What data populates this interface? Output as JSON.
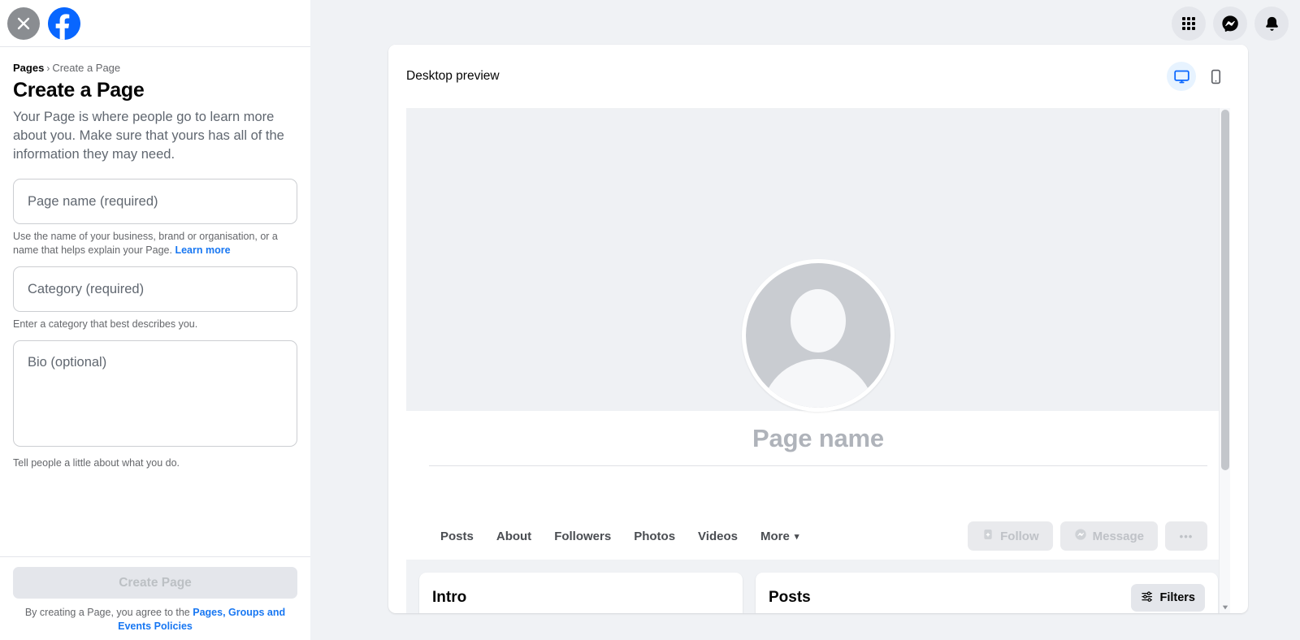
{
  "sidebar": {
    "close_icon": "close-icon",
    "logo_icon": "facebook-logo-icon",
    "breadcrumb": {
      "root": "Pages",
      "separator": "›",
      "current": "Create a Page"
    },
    "title": "Create a Page",
    "description": "Your Page is where people go to learn more about you. Make sure that yours has all of the information they may need.",
    "fields": {
      "page_name": {
        "placeholder": "Page name (required)",
        "value": "",
        "help": "Use the name of your business, brand or organisation, or a name that helps explain your Page.",
        "help_link": "Learn more"
      },
      "category": {
        "placeholder": "Category (required)",
        "value": "",
        "help": "Enter a category that best describes you."
      },
      "bio": {
        "placeholder": "Bio (optional)",
        "value": "",
        "help": "Tell people a little about what you do."
      }
    },
    "submit": {
      "label": "Create Page",
      "disabled": true
    },
    "legal": {
      "prefix": "By creating a Page, you agree to the ",
      "link": "Pages, Groups and Events Policies"
    }
  },
  "topbar": {
    "icons": [
      {
        "name": "apps-grid-icon",
        "label": "Menu"
      },
      {
        "name": "messenger-icon",
        "label": "Messenger"
      },
      {
        "name": "bell-icon",
        "label": "Notifications"
      }
    ]
  },
  "preview": {
    "header_title": "Desktop preview",
    "devices": [
      {
        "name": "desktop-preview-icon",
        "label": "Desktop",
        "active": true
      },
      {
        "name": "mobile-preview-icon",
        "label": "Mobile",
        "active": false
      }
    ],
    "page_name_placeholder": "Page name",
    "avatar_icon": "default-avatar-icon",
    "tabs": [
      {
        "label": "Posts",
        "has_caret": false
      },
      {
        "label": "About",
        "has_caret": false
      },
      {
        "label": "Followers",
        "has_caret": false
      },
      {
        "label": "Photos",
        "has_caret": false
      },
      {
        "label": "Videos",
        "has_caret": false
      },
      {
        "label": "More",
        "has_caret": true
      }
    ],
    "caret": "▾",
    "actions": [
      {
        "name": "follow-button",
        "label": "Follow",
        "icon": "person-add-icon",
        "disabled": true
      },
      {
        "name": "message-button",
        "label": "Message",
        "icon": "messenger-icon",
        "disabled": true
      },
      {
        "name": "more-options-button",
        "label": "•••",
        "icon": "ellipsis-icon",
        "disabled": true
      }
    ],
    "cards": {
      "intro": {
        "title": "Intro"
      },
      "posts": {
        "title": "Posts",
        "filters_label": "Filters",
        "filters_icon": "filter-sliders-icon"
      }
    },
    "scrollbar": {
      "up_arrow": "▲",
      "down_arrow": "▼"
    }
  },
  "colors": {
    "brand_blue": "#0866ff",
    "link_blue": "#1877f2",
    "page_bg": "#f0f2f5",
    "card_bg": "#ffffff",
    "disabled_text": "#bcc0c4",
    "muted_text": "#65676b"
  }
}
